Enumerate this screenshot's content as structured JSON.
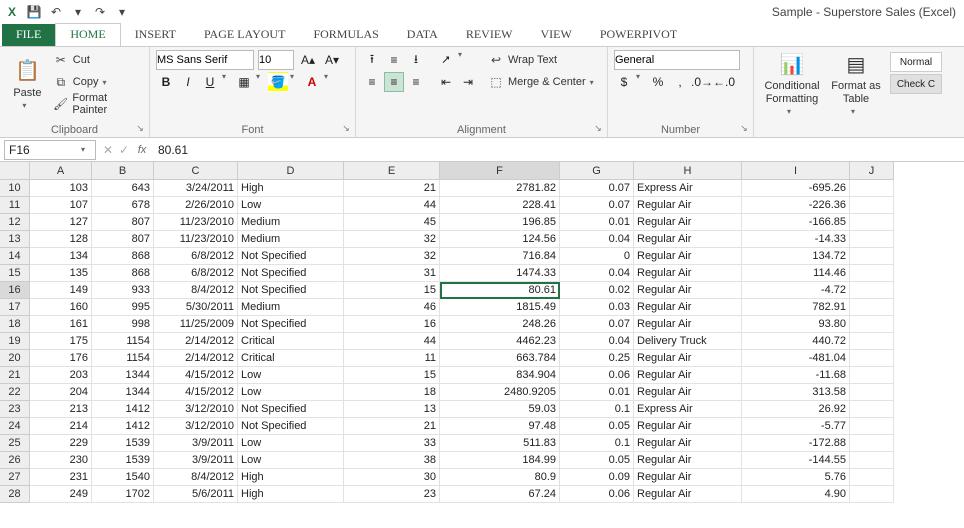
{
  "title": "Sample - Superstore Sales (Excel)",
  "qat": {
    "save": "💾",
    "undo": "↶",
    "redo": "↷"
  },
  "tabs": [
    "FILE",
    "HOME",
    "INSERT",
    "PAGE LAYOUT",
    "FORMULAS",
    "DATA",
    "REVIEW",
    "VIEW",
    "POWERPIVOT"
  ],
  "active_tab": 1,
  "ribbon": {
    "clipboard": {
      "label": "Clipboard",
      "paste": "Paste",
      "cut": "Cut",
      "copy": "Copy",
      "fp": "Format Painter"
    },
    "font": {
      "label": "Font",
      "name": "MS Sans Serif",
      "size": "10"
    },
    "alignment": {
      "label": "Alignment",
      "wrap": "Wrap Text",
      "merge": "Merge & Center"
    },
    "number": {
      "label": "Number",
      "format": "General"
    },
    "styles": {
      "cf": "Conditional Formatting",
      "fat": "Format as Table",
      "normal": "Normal",
      "check": "Check C"
    }
  },
  "namebox": "F16",
  "formula": "80.61",
  "cols": [
    "A",
    "B",
    "C",
    "D",
    "E",
    "F",
    "G",
    "H",
    "I",
    "J"
  ],
  "col_align": [
    "r",
    "r",
    "r",
    "l",
    "r",
    "r",
    "r",
    "l",
    "r",
    "l"
  ],
  "sel": {
    "row": 16,
    "col": 5
  },
  "rows": [
    {
      "n": 10,
      "c": [
        "103",
        "643",
        "3/24/2011",
        "High",
        "21",
        "2781.82",
        "0.07",
        "Express Air",
        "-695.26",
        ""
      ]
    },
    {
      "n": 11,
      "c": [
        "107",
        "678",
        "2/26/2010",
        "Low",
        "44",
        "228.41",
        "0.07",
        "Regular Air",
        "-226.36",
        ""
      ]
    },
    {
      "n": 12,
      "c": [
        "127",
        "807",
        "11/23/2010",
        "Medium",
        "45",
        "196.85",
        "0.01",
        "Regular Air",
        "-166.85",
        ""
      ]
    },
    {
      "n": 13,
      "c": [
        "128",
        "807",
        "11/23/2010",
        "Medium",
        "32",
        "124.56",
        "0.04",
        "Regular Air",
        "-14.33",
        ""
      ]
    },
    {
      "n": 14,
      "c": [
        "134",
        "868",
        "6/8/2012",
        "Not Specified",
        "32",
        "716.84",
        "0",
        "Regular Air",
        "134.72",
        ""
      ]
    },
    {
      "n": 15,
      "c": [
        "135",
        "868",
        "6/8/2012",
        "Not Specified",
        "31",
        "1474.33",
        "0.04",
        "Regular Air",
        "114.46",
        ""
      ]
    },
    {
      "n": 16,
      "c": [
        "149",
        "933",
        "8/4/2012",
        "Not Specified",
        "15",
        "80.61",
        "0.02",
        "Regular Air",
        "-4.72",
        ""
      ]
    },
    {
      "n": 17,
      "c": [
        "160",
        "995",
        "5/30/2011",
        "Medium",
        "46",
        "1815.49",
        "0.03",
        "Regular Air",
        "782.91",
        ""
      ]
    },
    {
      "n": 18,
      "c": [
        "161",
        "998",
        "11/25/2009",
        "Not Specified",
        "16",
        "248.26",
        "0.07",
        "Regular Air",
        "93.80",
        ""
      ]
    },
    {
      "n": 19,
      "c": [
        "175",
        "1154",
        "2/14/2012",
        "Critical",
        "44",
        "4462.23",
        "0.04",
        "Delivery Truck",
        "440.72",
        ""
      ]
    },
    {
      "n": 20,
      "c": [
        "176",
        "1154",
        "2/14/2012",
        "Critical",
        "11",
        "663.784",
        "0.25",
        "Regular Air",
        "-481.04",
        ""
      ]
    },
    {
      "n": 21,
      "c": [
        "203",
        "1344",
        "4/15/2012",
        "Low",
        "15",
        "834.904",
        "0.06",
        "Regular Air",
        "-11.68",
        ""
      ]
    },
    {
      "n": 22,
      "c": [
        "204",
        "1344",
        "4/15/2012",
        "Low",
        "18",
        "2480.9205",
        "0.01",
        "Regular Air",
        "313.58",
        ""
      ]
    },
    {
      "n": 23,
      "c": [
        "213",
        "1412",
        "3/12/2010",
        "Not Specified",
        "13",
        "59.03",
        "0.1",
        "Express Air",
        "26.92",
        ""
      ]
    },
    {
      "n": 24,
      "c": [
        "214",
        "1412",
        "3/12/2010",
        "Not Specified",
        "21",
        "97.48",
        "0.05",
        "Regular Air",
        "-5.77",
        ""
      ]
    },
    {
      "n": 25,
      "c": [
        "229",
        "1539",
        "3/9/2011",
        "Low",
        "33",
        "511.83",
        "0.1",
        "Regular Air",
        "-172.88",
        ""
      ]
    },
    {
      "n": 26,
      "c": [
        "230",
        "1539",
        "3/9/2011",
        "Low",
        "38",
        "184.99",
        "0.05",
        "Regular Air",
        "-144.55",
        ""
      ]
    },
    {
      "n": 27,
      "c": [
        "231",
        "1540",
        "8/4/2012",
        "High",
        "30",
        "80.9",
        "0.09",
        "Regular Air",
        "5.76",
        ""
      ]
    },
    {
      "n": 28,
      "c": [
        "249",
        "1702",
        "5/6/2011",
        "High",
        "23",
        "67.24",
        "0.06",
        "Regular Air",
        "4.90",
        ""
      ]
    }
  ]
}
